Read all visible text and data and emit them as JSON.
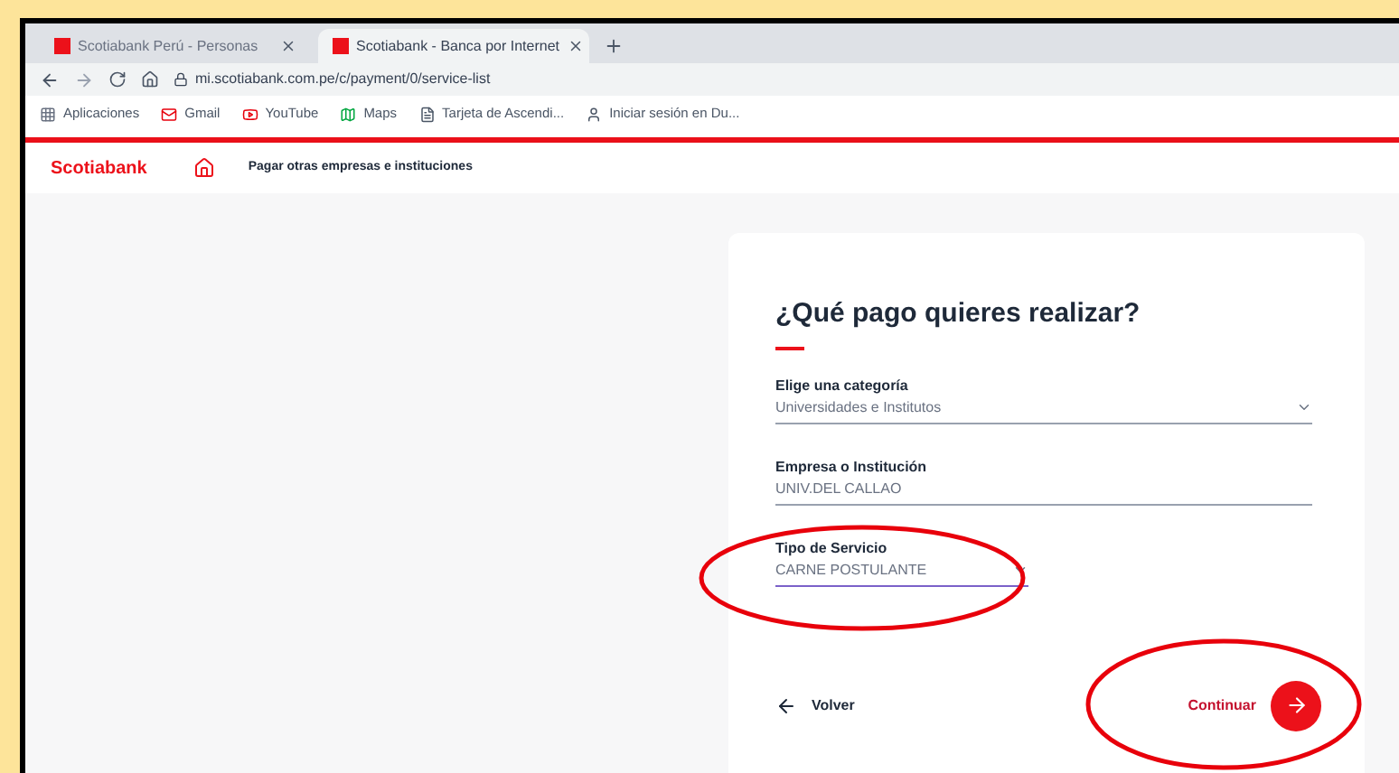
{
  "tabs": [
    {
      "label": "Scotiabank Perú - Personas",
      "selected": false
    },
    {
      "label": "Scotiabank - Banca por Internet",
      "selected": true
    }
  ],
  "address": "mi.scotiabank.com.pe/c/payment/0/service-list",
  "bookmarks": [
    {
      "label": "Aplicaciones",
      "kind": "apps"
    },
    {
      "label": "Gmail",
      "kind": "mail"
    },
    {
      "label": "YouTube",
      "kind": "video"
    },
    {
      "label": "Maps",
      "kind": "map"
    },
    {
      "label": "Tarjeta de Ascendi...",
      "kind": "doc"
    },
    {
      "label": "Iniciar sesión en Du...",
      "kind": "person"
    }
  ],
  "header": {
    "logo": "Scotiabank",
    "breadcrumb": "Pagar otras empresas e instituciones"
  },
  "form": {
    "title": "¿Qué pago quieres realizar?",
    "fields": [
      {
        "label": "Elige una categoría",
        "value": "Universidades e Institutos",
        "kind": "select",
        "focused": false,
        "wide": true
      },
      {
        "label": "Empresa o Institución",
        "value": "UNIV.DEL CALLAO",
        "kind": "text",
        "focused": false,
        "wide": true
      },
      {
        "label": "Tipo de Servicio",
        "value": "CARNE POSTULANTE",
        "kind": "select",
        "focused": true,
        "wide": false
      }
    ],
    "back": "Volver",
    "next": "Continuar"
  }
}
